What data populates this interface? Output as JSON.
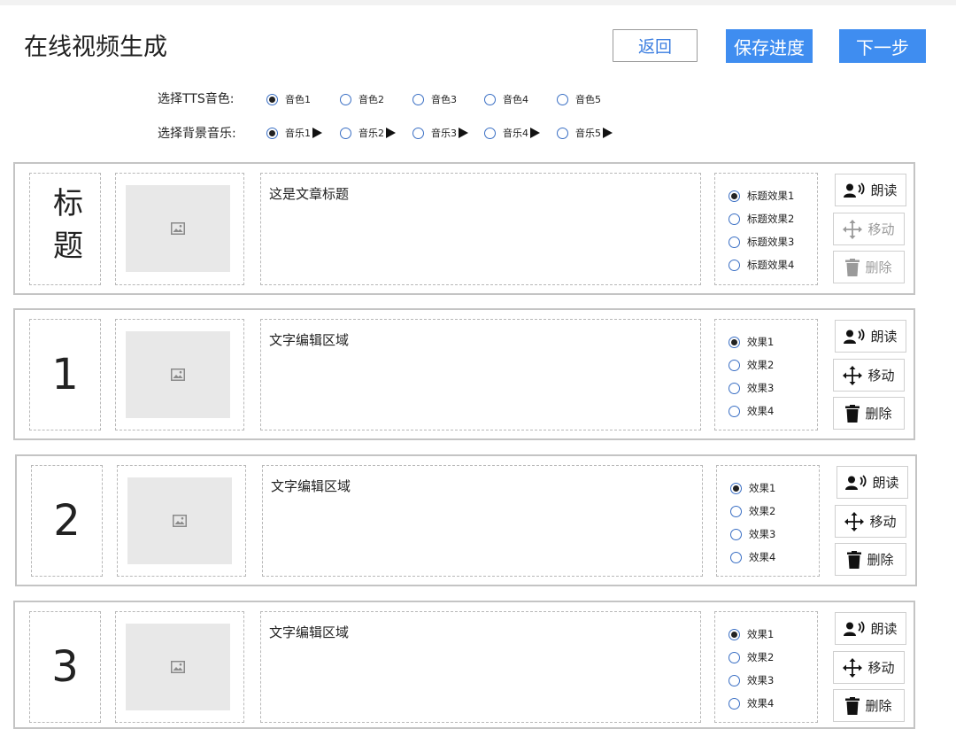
{
  "header": {
    "title": "在线视频生成",
    "back_label": "返回",
    "save_label": "保存进度",
    "next_label": "下一步"
  },
  "tts": {
    "label": "选择TTS音色:",
    "options": [
      "音色1",
      "音色2",
      "音色3",
      "音色4",
      "音色5"
    ],
    "selected": "音色1"
  },
  "music": {
    "label": "选择背景音乐:",
    "options": [
      "音乐1",
      "音乐2",
      "音乐3",
      "音乐4",
      "音乐5"
    ],
    "selected": "音乐1"
  },
  "cards": [
    {
      "label": "标题",
      "text": "这是文章标题",
      "effects": [
        "标题效果1",
        "标题效果2",
        "标题效果3",
        "标题效果4"
      ],
      "selected_effect": "标题效果1",
      "actions": {
        "read": "朗读",
        "move": "移动",
        "delete": "删除"
      },
      "move_disabled": true,
      "delete_disabled": true
    },
    {
      "label": "1",
      "text": "文字编辑区域",
      "effects": [
        "效果1",
        "效果2",
        "效果3",
        "效果4"
      ],
      "selected_effect": "效果1",
      "actions": {
        "read": "朗读",
        "move": "移动",
        "delete": "删除"
      },
      "move_disabled": false,
      "delete_disabled": false
    },
    {
      "label": "2",
      "text": "文字编辑区域",
      "effects": [
        "效果1",
        "效果2",
        "效果3",
        "效果4"
      ],
      "selected_effect": "效果1",
      "actions": {
        "read": "朗读",
        "move": "移动",
        "delete": "删除"
      },
      "move_disabled": false,
      "delete_disabled": false
    },
    {
      "label": "3",
      "text": "文字编辑区域",
      "effects": [
        "效果1",
        "效果2",
        "效果3",
        "效果4"
      ],
      "selected_effect": "效果1",
      "actions": {
        "read": "朗读",
        "move": "移动",
        "delete": "删除"
      },
      "move_disabled": false,
      "delete_disabled": false
    }
  ],
  "colors": {
    "accent": "#3f8df0",
    "radio_border": "#3a6fc4",
    "disabled_text": "#9a9a9a"
  }
}
